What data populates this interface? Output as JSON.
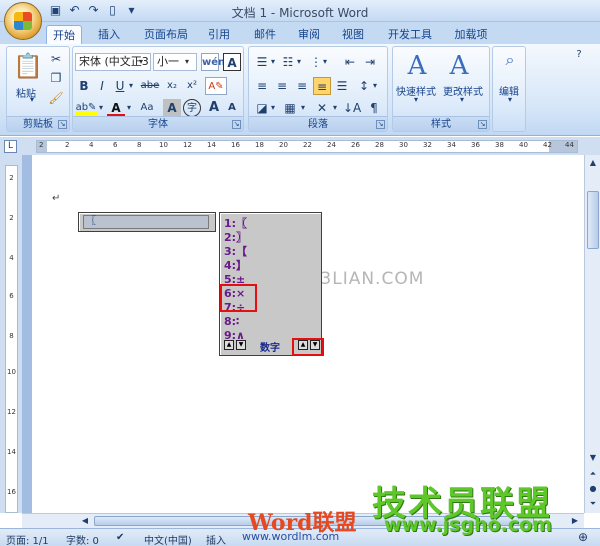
{
  "window": {
    "title": "文档 1 - Microsoft Word"
  },
  "qat": [
    "save-icon",
    "undo-icon",
    "redo-icon",
    "new-doc-icon",
    "customize-icon"
  ],
  "tabs": [
    "开始",
    "插入",
    "页面布局",
    "引用",
    "邮件",
    "审阅",
    "视图",
    "开发工具",
    "加载项"
  ],
  "ribbon": {
    "clipboard": {
      "label": "剪贴板",
      "paste_label": "粘贴"
    },
    "font": {
      "label": "字体",
      "font_name": "宋体 (中文正3",
      "font_size": "小一",
      "bold": "B",
      "italic": "I",
      "underline": "U",
      "strike": "abe",
      "subscript": "x₂",
      "superscript": "x²",
      "grow": "A",
      "shrink": "A",
      "clear": "Aa",
      "char_border": "A",
      "char_shade": "A",
      "font_color": "A",
      "phonetic": "wén"
    },
    "paragraph": {
      "label": "段落"
    },
    "styles": {
      "label": "样式",
      "quick_styles": "快速样式",
      "change_styles": "更改样式"
    },
    "editing": {
      "label": "编辑"
    }
  },
  "ruler": {
    "ticks": [
      "2",
      "2",
      "4",
      "6",
      "8",
      "10",
      "12",
      "14",
      "16",
      "18",
      "20",
      "22",
      "24",
      "26",
      "28",
      "30",
      "32",
      "34",
      "36",
      "38",
      "40",
      "42",
      "44"
    ]
  },
  "vruler": {
    "ticks": [
      "2",
      "2",
      "4",
      "6",
      "8",
      "10",
      "12",
      "14",
      "16"
    ]
  },
  "document": {
    "paragraph_mark": "↵"
  },
  "ime": {
    "input": "〖",
    "candidates": [
      "1:〖",
      "2:〗",
      "3:【",
      "4:】",
      "5:±",
      "6:×",
      "7:÷",
      "8:∶",
      "9:∧"
    ],
    "mode": "数字"
  },
  "status": {
    "page": "页面: 1/1",
    "words": "字数: 0",
    "language": "中文(中国)",
    "insert": "插入"
  },
  "watermarks": {
    "center": "三联网 3LIAN.COM",
    "logo": "技术员联盟",
    "url": "www.jsgho.com",
    "word_logo": "Word联盟",
    "word_url": "www.wordlm.com"
  }
}
